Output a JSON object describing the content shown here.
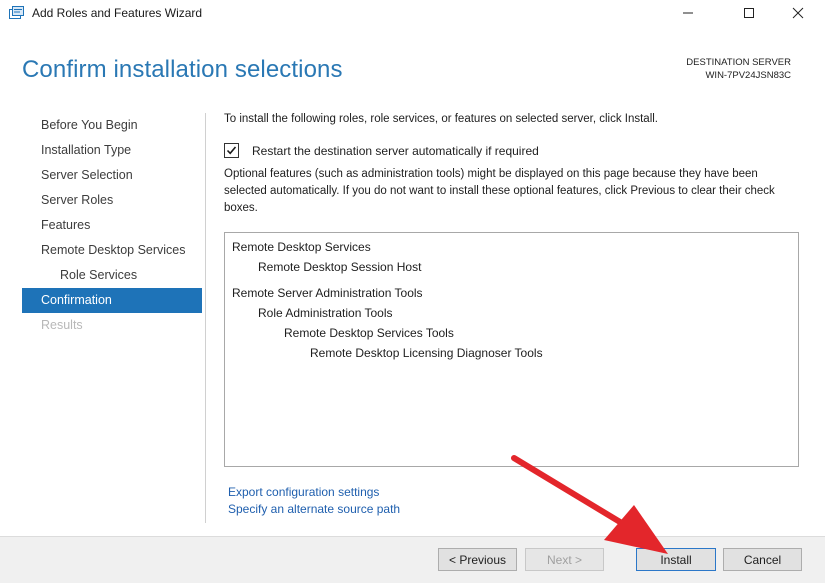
{
  "window": {
    "title": "Add Roles and Features Wizard",
    "icon": "server-manager-icon"
  },
  "header": {
    "page_title": "Confirm installation selections",
    "destination_label": "DESTINATION SERVER",
    "destination_server": "WIN-7PV24JSN83C"
  },
  "nav": {
    "items": [
      {
        "label": "Before You Begin",
        "state": "normal"
      },
      {
        "label": "Installation Type",
        "state": "normal"
      },
      {
        "label": "Server Selection",
        "state": "normal"
      },
      {
        "label": "Server Roles",
        "state": "normal"
      },
      {
        "label": "Features",
        "state": "normal"
      },
      {
        "label": "Remote Desktop Services",
        "state": "normal"
      },
      {
        "label": "Role Services",
        "state": "normal"
      },
      {
        "label": "Confirmation",
        "state": "active"
      },
      {
        "label": "Results",
        "state": "disabled"
      }
    ]
  },
  "content": {
    "intro": "To install the following roles, role services, or features on selected server, click Install.",
    "restart_checkbox": {
      "label": "Restart the destination server automatically if required",
      "checked": true
    },
    "optional_note": "Optional features (such as administration tools) might be displayed on this page because they have been selected automatically. If you do not want to install these optional features, click Previous to clear their check boxes.",
    "selections": [
      {
        "label": "Remote Desktop Services",
        "level": 0
      },
      {
        "label": "Remote Desktop Session Host",
        "level": 1
      },
      {
        "label": "Remote Server Administration Tools",
        "level": 0
      },
      {
        "label": "Role Administration Tools",
        "level": 1
      },
      {
        "label": "Remote Desktop Services Tools",
        "level": 2
      },
      {
        "label": "Remote Desktop Licensing Diagnoser Tools",
        "level": 3
      }
    ],
    "links": {
      "export": "Export configuration settings",
      "alternate_source": "Specify an alternate source path"
    }
  },
  "footer": {
    "previous": "< Previous",
    "next": "Next >",
    "install": "Install",
    "cancel": "Cancel"
  },
  "annotation": {
    "arrow_color": "#e3262b"
  },
  "colors": {
    "title_blue": "#2a78b4",
    "nav_active": "#1e73b8",
    "link_blue": "#1f5fae"
  }
}
